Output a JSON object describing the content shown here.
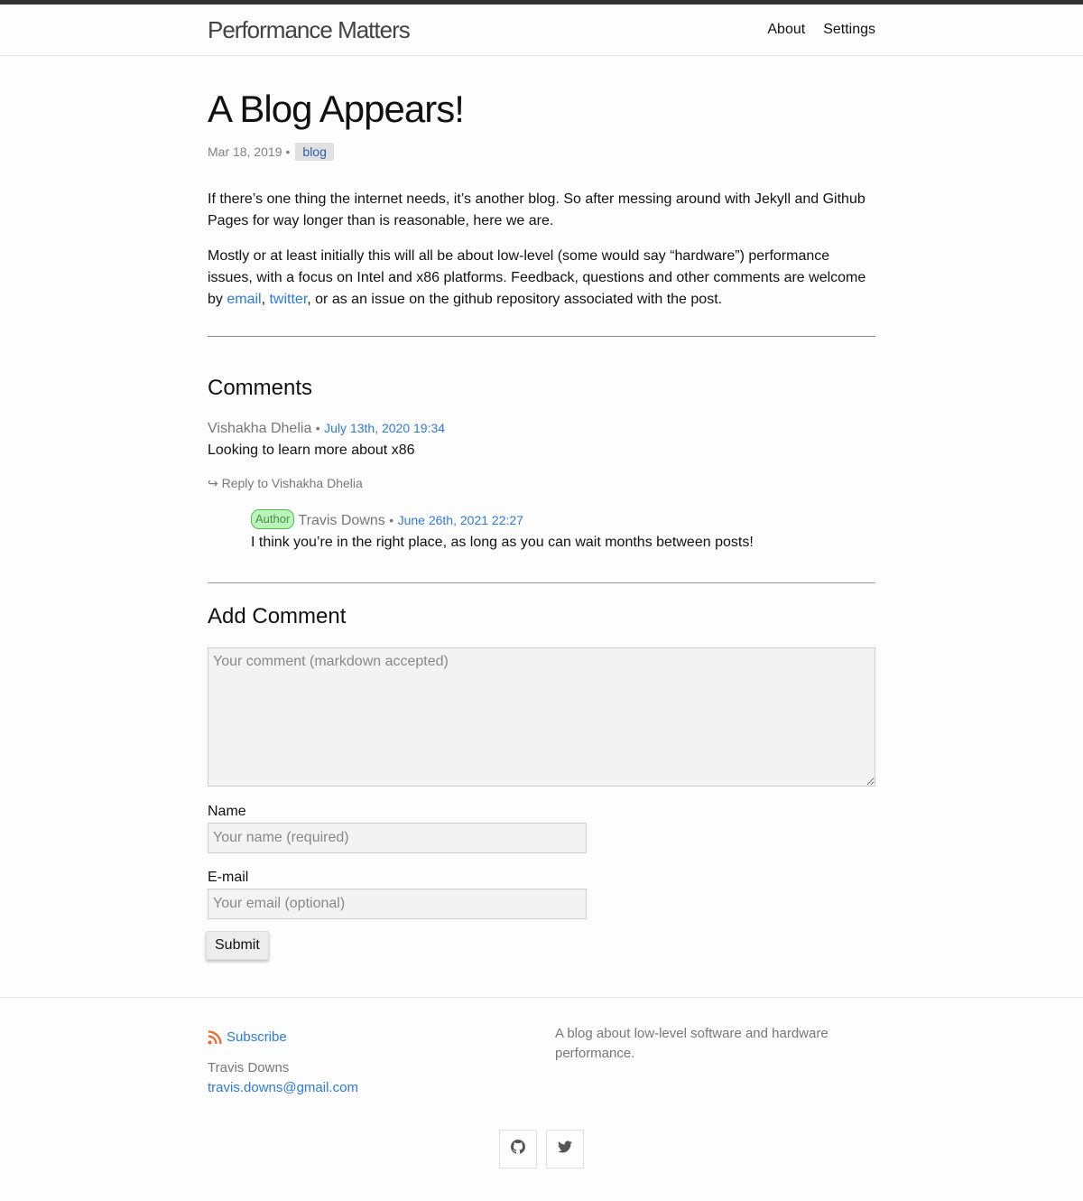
{
  "header": {
    "site_title": "Performance Matters",
    "nav": [
      "About",
      "Settings"
    ]
  },
  "post": {
    "title": "A Blog Appears!",
    "date": "Mar 18, 2019",
    "meta_separator": "•",
    "tag": "blog",
    "para1": "If there’s one thing the internet needs, it’s another blog. So after messing around with Jekyll and Github Pages for way longer than is reasonable, here we are.",
    "para2_before": "Mostly or at least initially this will all be about low-level (some would say “hardware”) performance issues, with a focus on Intel and x86 platforms. Feedback, questions and other comments are welcome by ",
    "para2_email_link": "email",
    "para2_comma": ", ",
    "para2_twitter_link": "twitter",
    "para2_after": ", or as an issue on the github repository associated with the post."
  },
  "comments": {
    "heading": "Comments",
    "items": [
      {
        "author": "Vishakha Dhelia",
        "separator": "•",
        "date": "July 13th, 2020 19:34",
        "body": "Looking to learn more about x86",
        "reply_label": "↪ Reply to Vishakha Dhelia",
        "reply": {
          "badge": "Author",
          "author": "Travis Downs",
          "separator": "•",
          "date": "June 26th, 2021 22:27",
          "body": "I think you’re in the right place, as long as you can wait months between posts!"
        }
      }
    ]
  },
  "form": {
    "heading": "Add Comment",
    "comment_placeholder": "Your comment (markdown accepted)",
    "name_label": "Name",
    "name_placeholder": "Your name (required)",
    "email_label": "E-mail",
    "email_placeholder": "Your email (optional)",
    "submit_label": "Submit"
  },
  "footer": {
    "subscribe_label": "Subscribe",
    "author_name": "Travis Downs",
    "author_email": "travis.downs@gmail.com",
    "description": "A blog about low-level software and hardware performance.",
    "icons": [
      "rss-icon",
      "github-icon",
      "twitter-icon"
    ],
    "accent_color": "#2a7ae2",
    "rss_color": "#f26522"
  }
}
